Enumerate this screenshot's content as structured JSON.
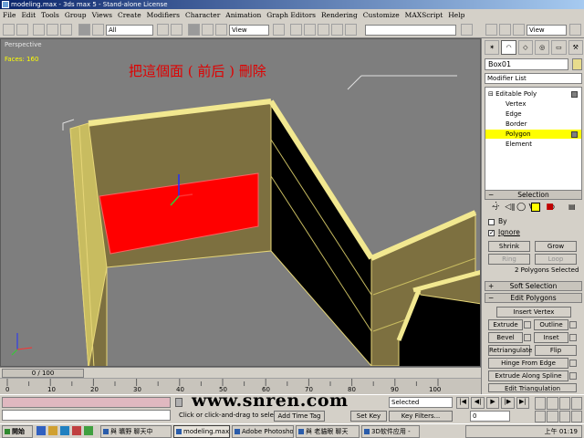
{
  "window": {
    "title": "modeling.max - 3ds max 5 - Stand-alone License"
  },
  "menu": [
    "File",
    "Edit",
    "Tools",
    "Group",
    "Views",
    "Create",
    "Modifiers",
    "Character",
    "Animation",
    "Graph Editors",
    "Rendering",
    "Customize",
    "MAXScript",
    "Help"
  ],
  "toolbar": {
    "selection_filter": "All",
    "ref_coord": "View",
    "named_selection": "",
    "view_dropdown": "View"
  },
  "viewport": {
    "label": "Perspective",
    "faces": "Faces: 160",
    "annotation": "把這個面 ( 前后 ) 刪除"
  },
  "panel": {
    "tabs": [
      "create-icon",
      "modify-icon",
      "hierarchy-icon",
      "motion-icon",
      "display-icon",
      "utilities-icon"
    ],
    "object_name": "Box01",
    "modifier_list": "Modifier List",
    "stack": [
      "Editable Poly",
      "Vertex",
      "Edge",
      "Border",
      "Polygon",
      "Element"
    ],
    "selected_sub": "Polygon",
    "selection": {
      "title": "Selection",
      "by_label": "By",
      "ignore_label": "Ignore",
      "shrink": "Shrink",
      "grow": "Grow",
      "ring": "Ring",
      "loop": "Loop",
      "status": "2 Polygons Selected"
    },
    "soft_selection": "Soft Selection",
    "edit_polygons": {
      "title": "Edit Polygons",
      "insert_vertex": "Insert Vertex",
      "extrude": "Extrude",
      "outline": "Outline",
      "bevel": "Bevel",
      "inset": "Inset",
      "retriangulate": "Retriangulate",
      "flip": "Flip",
      "hinge": "Hinge From Edge",
      "extrude_spline": "Extrude Along Spline",
      "edit_triangulation": "Edit Triangulation"
    }
  },
  "timeslider": {
    "label": "0 / 100"
  },
  "trackbar": {
    "ticks": [
      "0",
      "10",
      "20",
      "30",
      "40",
      "50",
      "60",
      "70",
      "80",
      "90",
      "100"
    ]
  },
  "status": {
    "prompt": "Click or click-and-drag to sele",
    "add_time_tag": "Add Time Tag",
    "set_key": "Set Key",
    "key_filters": "Key Filters...",
    "selected": "Selected",
    "frame": "0",
    "watermark": "www.snren.com"
  },
  "taskbar": {
    "start": "開始",
    "tasks": [
      "與 曠野 聊天中",
      "modeling.max -",
      "Adobe Photoshop",
      "與 老貓眼 聊天",
      "3D软件应用 -"
    ],
    "clock": "上午 01:19"
  },
  "colors": {
    "selected_poly": "#ff0000",
    "wall": "#7d7040",
    "wall_edge": "#e6d678",
    "dark_face": "#000000",
    "stack_highlight": "#ffff00"
  }
}
